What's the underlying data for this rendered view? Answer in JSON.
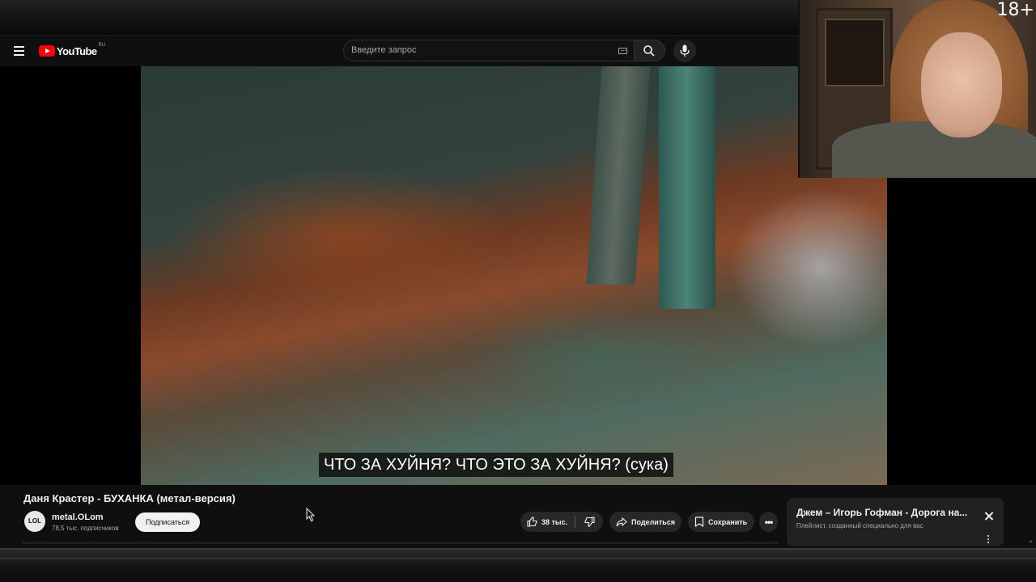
{
  "masthead": {
    "logo_text": "YouTube",
    "logo_region": "RU",
    "search_placeholder": "Введите запрос"
  },
  "player": {
    "caption": "ЧТО ЗА ХУЙНЯ? ЧТО ЭТО ЗА ХУЙНЯ? (сука)"
  },
  "overlay": {
    "age_badge": "18+"
  },
  "video": {
    "title": "Даня Крастер - БУХАНКА (метал-версия)",
    "channel": {
      "avatar_text": "LOL",
      "name": "metal.OLom",
      "subscribers": "78,5 тыс. подписчиков",
      "subscribe_label": "Подписаться"
    },
    "actions": {
      "likes": "38 тыс.",
      "share_label": "Поделиться",
      "save_label": "Сохранить",
      "more_label": "•••"
    }
  },
  "notification": {
    "title": "Джем – Игорь Гофман - Дорога на...",
    "subtitle": "Плейлист, созданный специально для вас"
  },
  "colors": {
    "brand_red": "#ff0000",
    "background": "#0f0f0f",
    "pill": "#272727"
  }
}
